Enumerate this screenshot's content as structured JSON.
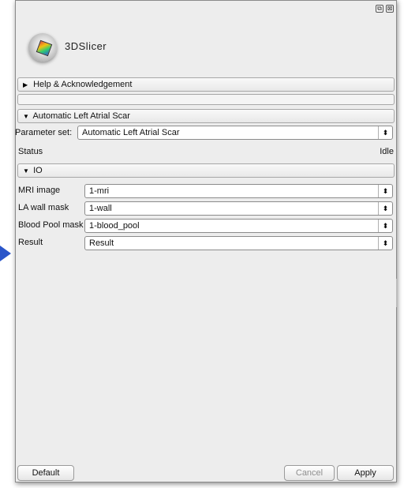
{
  "window": {
    "float_icon": "⧉",
    "close_icon": "⊠"
  },
  "logo": {
    "text": "3DSlicer",
    "icon": "slicer-logo-icon"
  },
  "sections": {
    "help": {
      "label": "Help & Acknowledgement",
      "collapsed": true
    },
    "scar": {
      "label": "Automatic Left Atrial Scar",
      "collapsed": false
    },
    "io": {
      "label": "IO",
      "collapsed": false
    }
  },
  "parameter_set": {
    "label": "Parameter set:",
    "value": "Automatic Left Atrial Scar"
  },
  "status": {
    "label": "Status",
    "value": "Idle"
  },
  "io_fields": {
    "mri": {
      "label": "MRI image",
      "value": "1-mri"
    },
    "wall": {
      "label": "LA wall mask",
      "value": "1-wall"
    },
    "blood": {
      "label": "Blood Pool mask",
      "value": "1-blood_pool"
    },
    "result": {
      "label": "Result",
      "value": "Result"
    }
  },
  "buttons": {
    "default": "Default",
    "cancel": "Cancel",
    "apply": "Apply"
  },
  "colors": {
    "accent_arrow": "#2a55c9",
    "panel_bg": "#ededed"
  }
}
